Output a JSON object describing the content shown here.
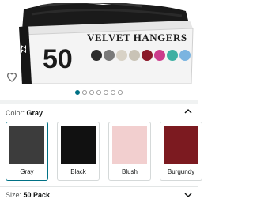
{
  "product_image": {
    "count": "50",
    "headline": "VELVET HANGERS",
    "brand_mark": "ZZ",
    "swatch_colors": [
      "#2b2b2b",
      "#7a7a7a",
      "#d8d2c6",
      "#c9c3b6",
      "#8b1a2a",
      "#cc3c8c",
      "#3fb0a3",
      "#7bb4e0"
    ]
  },
  "carousel": {
    "total": 7,
    "active_index": 0
  },
  "color_selector": {
    "label": "Color:",
    "selected": "Gray",
    "options": [
      {
        "name": "Gray",
        "color": "#3c3c3c"
      },
      {
        "name": "Black",
        "color": "#111111"
      },
      {
        "name": "Blush",
        "color": "#f2cfcf"
      },
      {
        "name": "Burgundy",
        "color": "#7c1a20"
      }
    ]
  },
  "size_selector": {
    "label": "Size:",
    "selected": "50 Pack"
  },
  "colors": {
    "accent": "#007185",
    "text": "#0f1111",
    "muted": "#565959"
  }
}
